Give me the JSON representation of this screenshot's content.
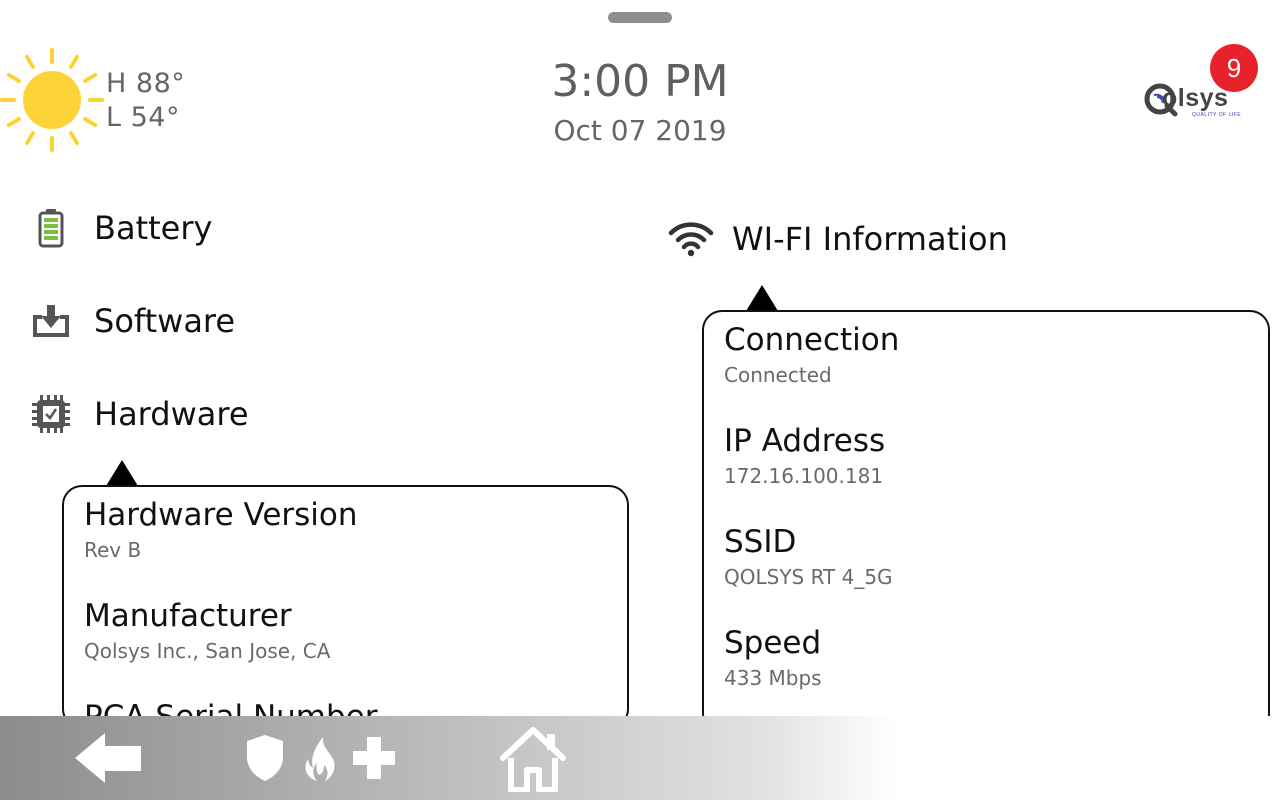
{
  "weather": {
    "icon": "sun-icon",
    "high": "H 88°",
    "low": "L 54°"
  },
  "clock": {
    "time": "3:00 PM",
    "date": "Oct 07 2019"
  },
  "brand": {
    "logo_text": "olsys",
    "tagline": "QUALITY OF LIFE",
    "notification_count": "9"
  },
  "menu": [
    {
      "label": "Battery",
      "icon": "battery-icon"
    },
    {
      "label": "Software",
      "icon": "download-tray-icon"
    },
    {
      "label": "Hardware",
      "icon": "chip-icon"
    }
  ],
  "wifi_menu": {
    "label": "WI-FI Information",
    "icon": "wifi-icon"
  },
  "hardware_panel": [
    {
      "title": "Hardware Version",
      "value": "Rev B"
    },
    {
      "title": "Manufacturer",
      "value": "Qolsys Inc., San Jose, CA"
    },
    {
      "title": "PCA Serial Number",
      "value": ""
    }
  ],
  "wifi_panel": [
    {
      "title": "Connection",
      "value": "Connected"
    },
    {
      "title": "IP Address",
      "value": "172.16.100.181"
    },
    {
      "title": "SSID",
      "value": "QOLSYS RT 4_5G"
    },
    {
      "title": "Speed",
      "value": "433 Mbps"
    }
  ],
  "bottom_bar": {
    "back": "back-arrow-icon",
    "emergency": [
      "shield-icon",
      "fire-icon",
      "plus-icon"
    ],
    "home": "home-icon"
  },
  "colors": {
    "sun": "#fdd338",
    "badge": "#e8222b",
    "battery": "#7bc043"
  }
}
